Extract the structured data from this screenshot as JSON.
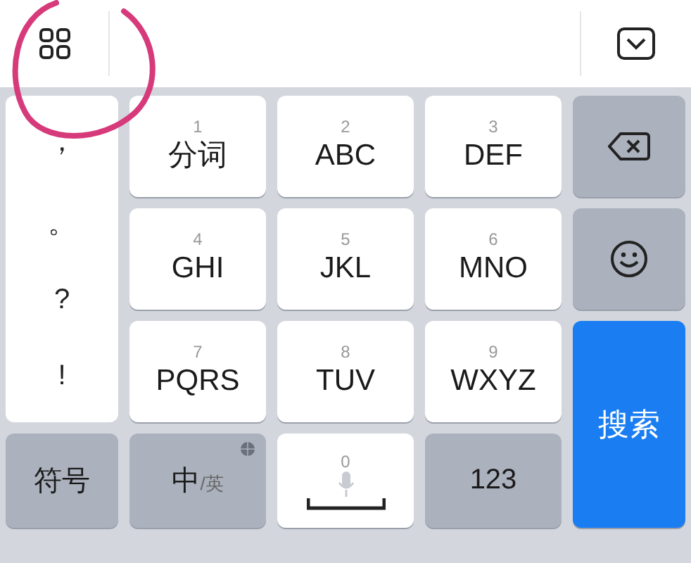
{
  "annotation": {
    "kind": "circle"
  },
  "punctuation_column": [
    "，",
    "。",
    "?",
    "!"
  ],
  "keys": [
    {
      "kind": "letter",
      "digit": "1",
      "label": "分词"
    },
    {
      "kind": "letter",
      "digit": "2",
      "label": "ABC"
    },
    {
      "kind": "letter",
      "digit": "3",
      "label": "DEF"
    },
    {
      "kind": "delete"
    },
    {
      "kind": "letter",
      "digit": "4",
      "label": "GHI"
    },
    {
      "kind": "letter",
      "digit": "5",
      "label": "JKL"
    },
    {
      "kind": "letter",
      "digit": "6",
      "label": "MNO"
    },
    {
      "kind": "emoji"
    },
    {
      "kind": "letter",
      "digit": "7",
      "label": "PQRS"
    },
    {
      "kind": "letter",
      "digit": "8",
      "label": "TUV"
    },
    {
      "kind": "letter",
      "digit": "9",
      "label": "WXYZ"
    },
    {
      "kind": "search",
      "label": "搜索"
    },
    {
      "kind": "function",
      "label": "符号"
    },
    {
      "kind": "lang",
      "label": "中",
      "sub": "/英"
    },
    {
      "kind": "space",
      "digit": "0"
    },
    {
      "kind": "function",
      "label": "123"
    }
  ]
}
